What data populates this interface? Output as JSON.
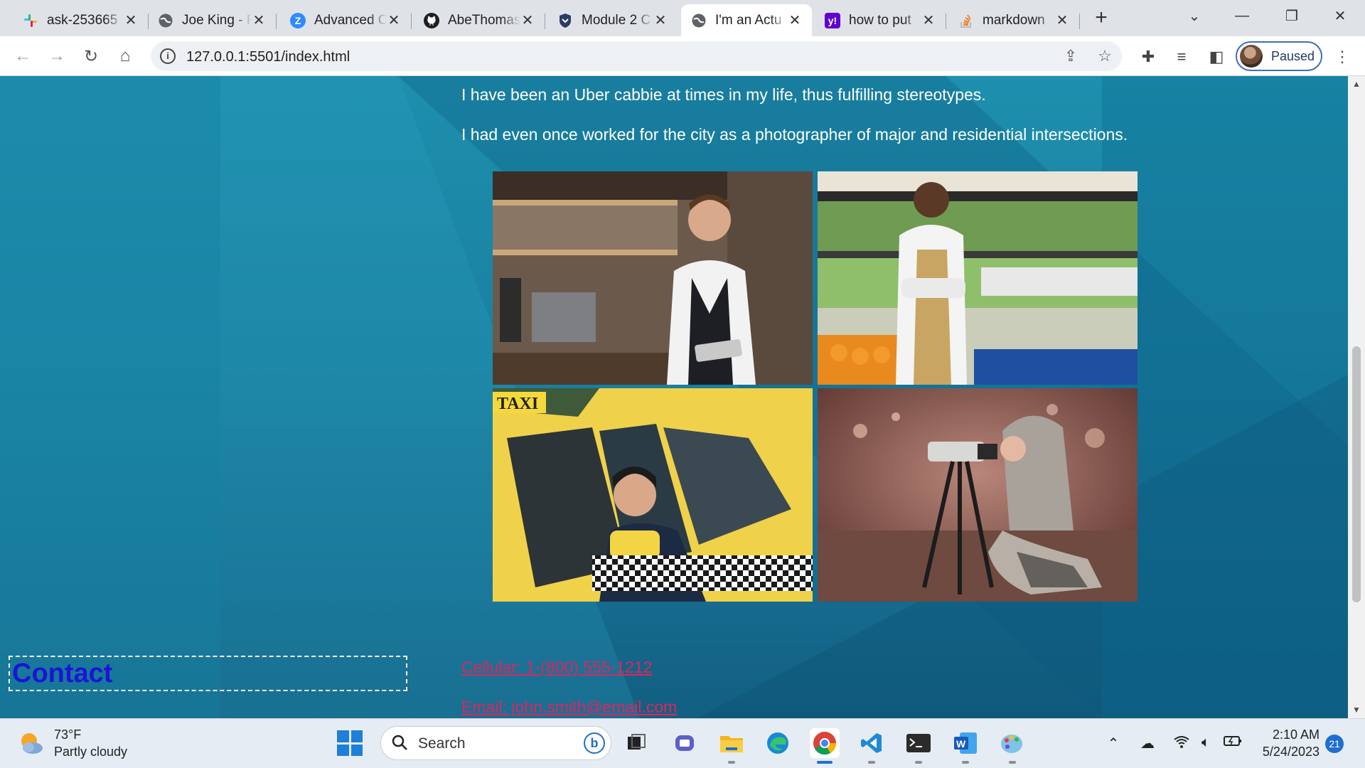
{
  "browser": {
    "tabs": [
      {
        "title": "ask-253665",
        "icon": "slack-icon",
        "color": "#4a154b"
      },
      {
        "title": "Joe King - P",
        "icon": "globe-icon",
        "color": "#5f6368"
      },
      {
        "title": "Advanced C",
        "icon": "zoom-icon",
        "color": "#2d8cff"
      },
      {
        "title": "AbeThomas",
        "icon": "github-icon",
        "color": "#1f1f1f"
      },
      {
        "title": "Module 2 C",
        "icon": "shield-icon",
        "color": "#2b3a67"
      },
      {
        "title": "I'm an Actu",
        "icon": "globe-icon",
        "color": "#5f6368",
        "active": true
      },
      {
        "title": "how to put",
        "icon": "yahoo-icon",
        "color": "#6001d2"
      },
      {
        "title": "markdown",
        "icon": "stack-overflow-icon",
        "color": "#f48024"
      }
    ],
    "url": "127.0.0.1:5501/index.html",
    "profile_label": "Paused"
  },
  "page": {
    "paragraphs": [
      "I have been an Uber cabbie at times in my life, thus fulfilling stereotypes.",
      "I had even once worked for the city as a photographer of major and residential intersections."
    ],
    "photos": [
      {
        "subject": "barista-photo"
      },
      {
        "subject": "grocer-photo"
      },
      {
        "subject": "taxi-driver-photo"
      },
      {
        "subject": "photographer-photo"
      }
    ],
    "contact_heading": "Contact",
    "phone_link": "Cellular: 1-(800) 555-1212",
    "email_link": "Email: john.smith@email.com"
  },
  "taskbar": {
    "temperature": "73°F",
    "weather": "Partly cloudy",
    "search_placeholder": "Search",
    "time": "2:10 AM",
    "date": "5/24/2023",
    "notifications": "21"
  }
}
